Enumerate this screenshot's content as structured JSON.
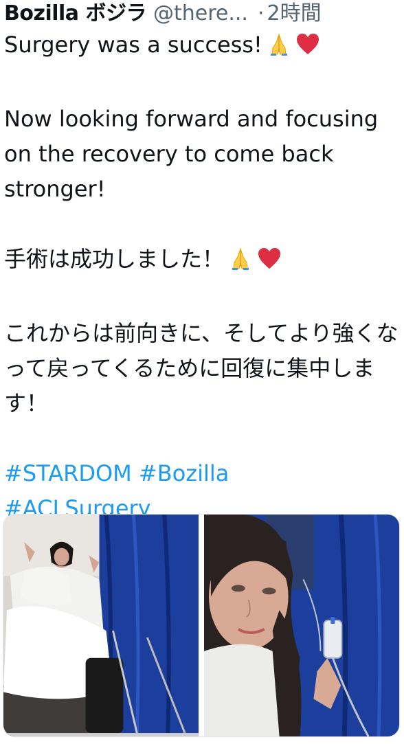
{
  "tweet": {
    "display_name": "Bozilla ボジラ",
    "handle": "@there...",
    "separator": "·",
    "timestamp": "2時間",
    "line_en_1": "Surgery was a success!",
    "line_en_2": "Now looking forward and focusing on the recovery to come back stronger!",
    "line_ja_1": "手術は成功しました！",
    "line_ja_2": "これからは前向きに、そしてより強くなって戻ってくるために回復に集中します！",
    "hashtags": [
      "#STARDOM",
      "#Bozilla",
      "#ACLSurgery"
    ],
    "emoji": [
      "folded-hands-emoji",
      "red-heart-emoji"
    ],
    "media": {
      "photo_1_icon": "hospital-bed-selfie-photo",
      "photo_2_icon": "hospital-selfie-photo"
    }
  },
  "colors": {
    "text": "#0f1419",
    "secondary": "#536471",
    "link": "#1d9bf0",
    "curtain_blue": "#1c3f9e"
  }
}
